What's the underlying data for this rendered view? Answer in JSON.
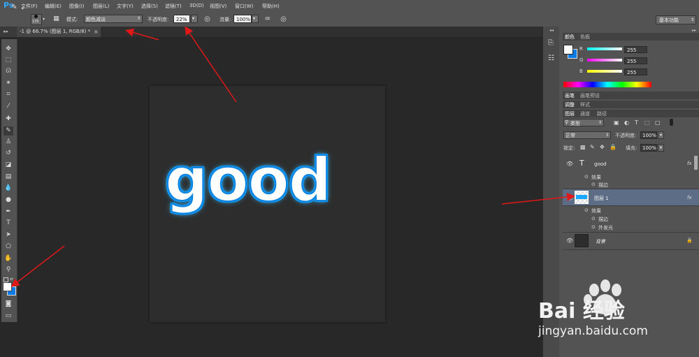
{
  "app": {
    "logo": "Ps"
  },
  "menu": [
    "文件(F)",
    "编辑(E)",
    "图像(I)",
    "图层(L)",
    "文字(Y)",
    "选择(S)",
    "滤镜(T)",
    "3D(D)",
    "视图(V)",
    "窗口(W)",
    "帮助(H)"
  ],
  "options": {
    "brush_size": "135",
    "mode_label": "模式:",
    "mode_value": "颜色减淡",
    "opacity_label": "不透明度:",
    "opacity_value": "22%",
    "flow_label": "流量:",
    "flow_value": "100%",
    "workspace": "基本功能"
  },
  "document": {
    "tab_title": "-1 @ 66.7% (图层 1, RGB/8) *",
    "close": "×"
  },
  "canvas": {
    "text": "good"
  },
  "color_panel": {
    "tabs": [
      "颜色",
      "色板"
    ],
    "channels": [
      {
        "label": "R",
        "value": "255"
      },
      {
        "label": "G",
        "value": "255"
      },
      {
        "label": "B",
        "value": "255"
      }
    ]
  },
  "brush_tabs": [
    "画笔",
    "画笔预设"
  ],
  "adjust_tabs": [
    "调整",
    "样式"
  ],
  "layers_panel": {
    "tabs": [
      "图层",
      "通道",
      "路径"
    ],
    "filter": "类型",
    "blend_mode": "正常",
    "opacity_label": "不透明度:",
    "opacity_value": "100%",
    "lock_label": "锁定:",
    "fill_label": "填充:",
    "fill_value": "100%",
    "layers": [
      {
        "name": "good",
        "thumb": "T",
        "fx": "fx",
        "effects_label": "效果",
        "effects": [
          "描边"
        ]
      },
      {
        "name": "图层 1",
        "fx": "fx",
        "effects_label": "效果",
        "effects": [
          "描边",
          "外发光"
        ]
      },
      {
        "name": "背景"
      }
    ]
  },
  "colors": {
    "accent": "#31a8ff",
    "arrow": "#e01818",
    "stroke": "#0a84e0"
  },
  "watermark": {
    "brand": "Bai 经验",
    "url": "jingyan.baidu.com"
  }
}
